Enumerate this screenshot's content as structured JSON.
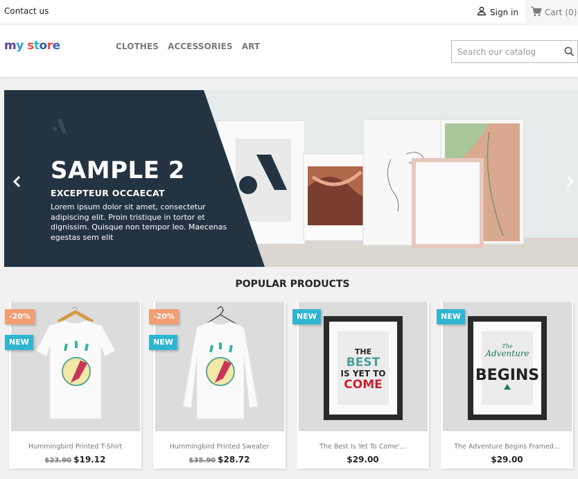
{
  "topnav": {
    "contact_label": "Contact us",
    "signin_label": "Sign in",
    "cart_label": "Cart",
    "cart_count": "(0)"
  },
  "header": {
    "logo_text": "my store",
    "menu": [
      {
        "label": "CLOTHES"
      },
      {
        "label": "ACCESSORIES"
      },
      {
        "label": "ART"
      }
    ],
    "search": {
      "placeholder": "Search our catalog",
      "value": ""
    }
  },
  "hero": {
    "title": "SAMPLE 2",
    "subtitle": "EXCEPTEUR OCCAECAT",
    "text": "Lorem ipsum dolor sit amet, consectetur adipiscing elit. Proin tristique in tortor et dignissim. Quisque non tempor leo. Maecenas egestas sem elit",
    "prev_icon": "chevron-left-icon",
    "next_icon": "chevron-right-icon"
  },
  "popular": {
    "title": "POPULAR PRODUCTS",
    "products": [
      {
        "name": "Hummingbird Printed T-Shirt",
        "old_price": "$23.90",
        "price": "$19.12",
        "discount": "-20%",
        "flag": "NEW"
      },
      {
        "name": "Hummingbird Printed Sweater",
        "old_price": "$35.90",
        "price": "$28.72",
        "discount": "-20%",
        "flag": "NEW"
      },
      {
        "name": "The Best Is Yet To Come'...",
        "old_price": "",
        "price": "$29.00",
        "discount": "",
        "flag": "NEW"
      },
      {
        "name": "The Adventure Begins Framed...",
        "old_price": "",
        "price": "$29.00",
        "discount": "",
        "flag": "NEW"
      }
    ]
  },
  "colors": {
    "accent": "#2fb5d2",
    "discount": "#f39d72",
    "hero_dark": "#233341"
  }
}
